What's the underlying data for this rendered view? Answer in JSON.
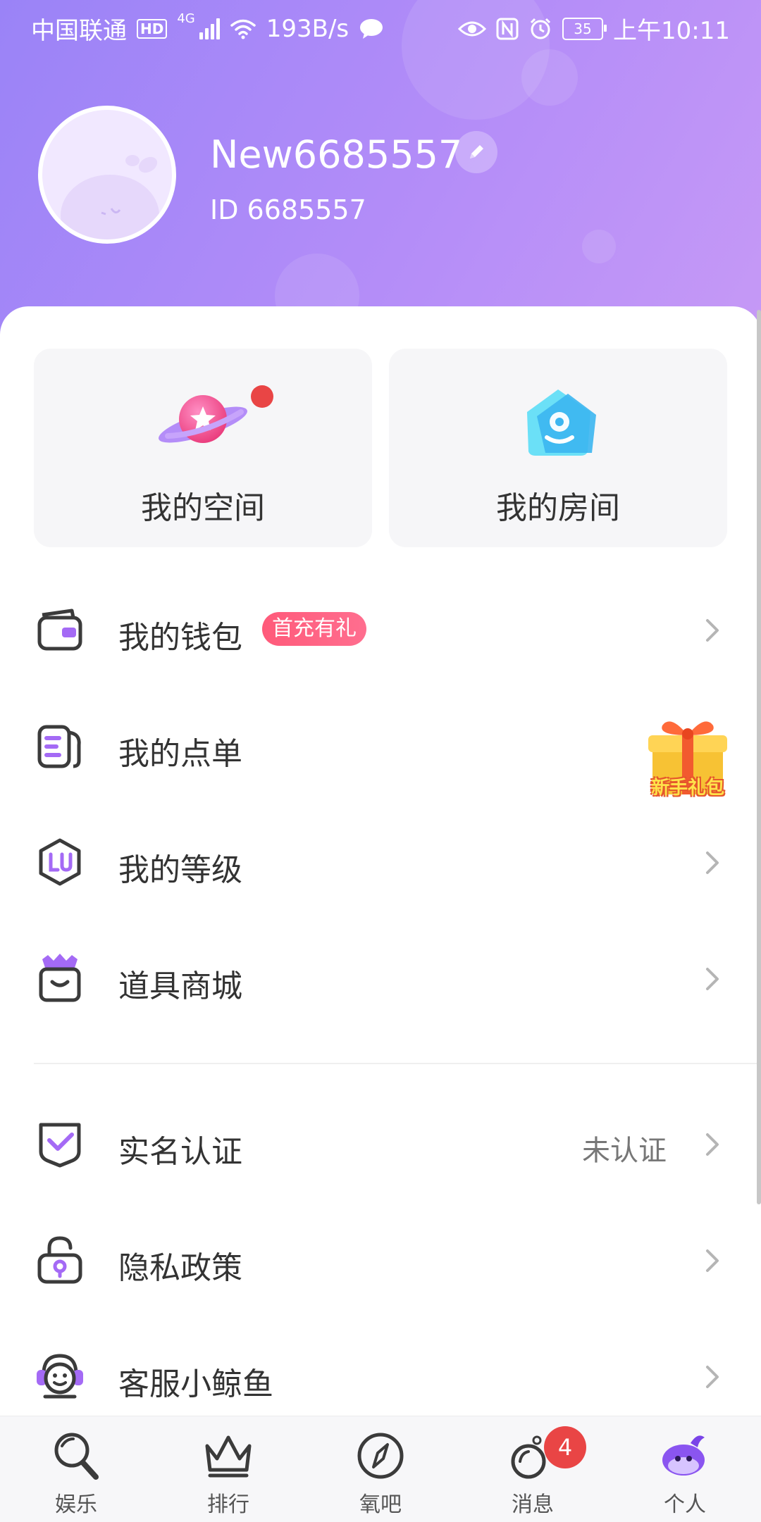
{
  "status_bar": {
    "carrier": "中国联通",
    "hd": "HD",
    "network": "4G",
    "speed": "193B/s",
    "battery": "35",
    "time": "上午10:11"
  },
  "profile": {
    "username": "New6685557",
    "user_id": "ID 6685557"
  },
  "tiles": [
    {
      "label": "我的空间"
    },
    {
      "label": "我的房间"
    }
  ],
  "menu": {
    "wallet": {
      "label": "我的钱包",
      "badge": "首充有礼"
    },
    "orders": {
      "label": "我的点单"
    },
    "level": {
      "label": "我的等级"
    },
    "shop": {
      "label": "道具商城"
    },
    "verify": {
      "label": "实名认证",
      "value": "未认证"
    },
    "privacy": {
      "label": "隐私政策"
    },
    "service": {
      "label": "客服小鲸鱼"
    }
  },
  "gift": {
    "label": "新手礼包"
  },
  "nav": {
    "items": [
      {
        "label": "娱乐"
      },
      {
        "label": "排行"
      },
      {
        "label": "氧吧"
      },
      {
        "label": "消息",
        "badge": "4"
      },
      {
        "label": "个人"
      }
    ]
  },
  "colors": {
    "accent": "#9b7cf5",
    "header_start": "#9a83f7",
    "header_end": "#c79af6",
    "badge_red": "#e94545",
    "promo_pink": "#ff5a7a"
  }
}
